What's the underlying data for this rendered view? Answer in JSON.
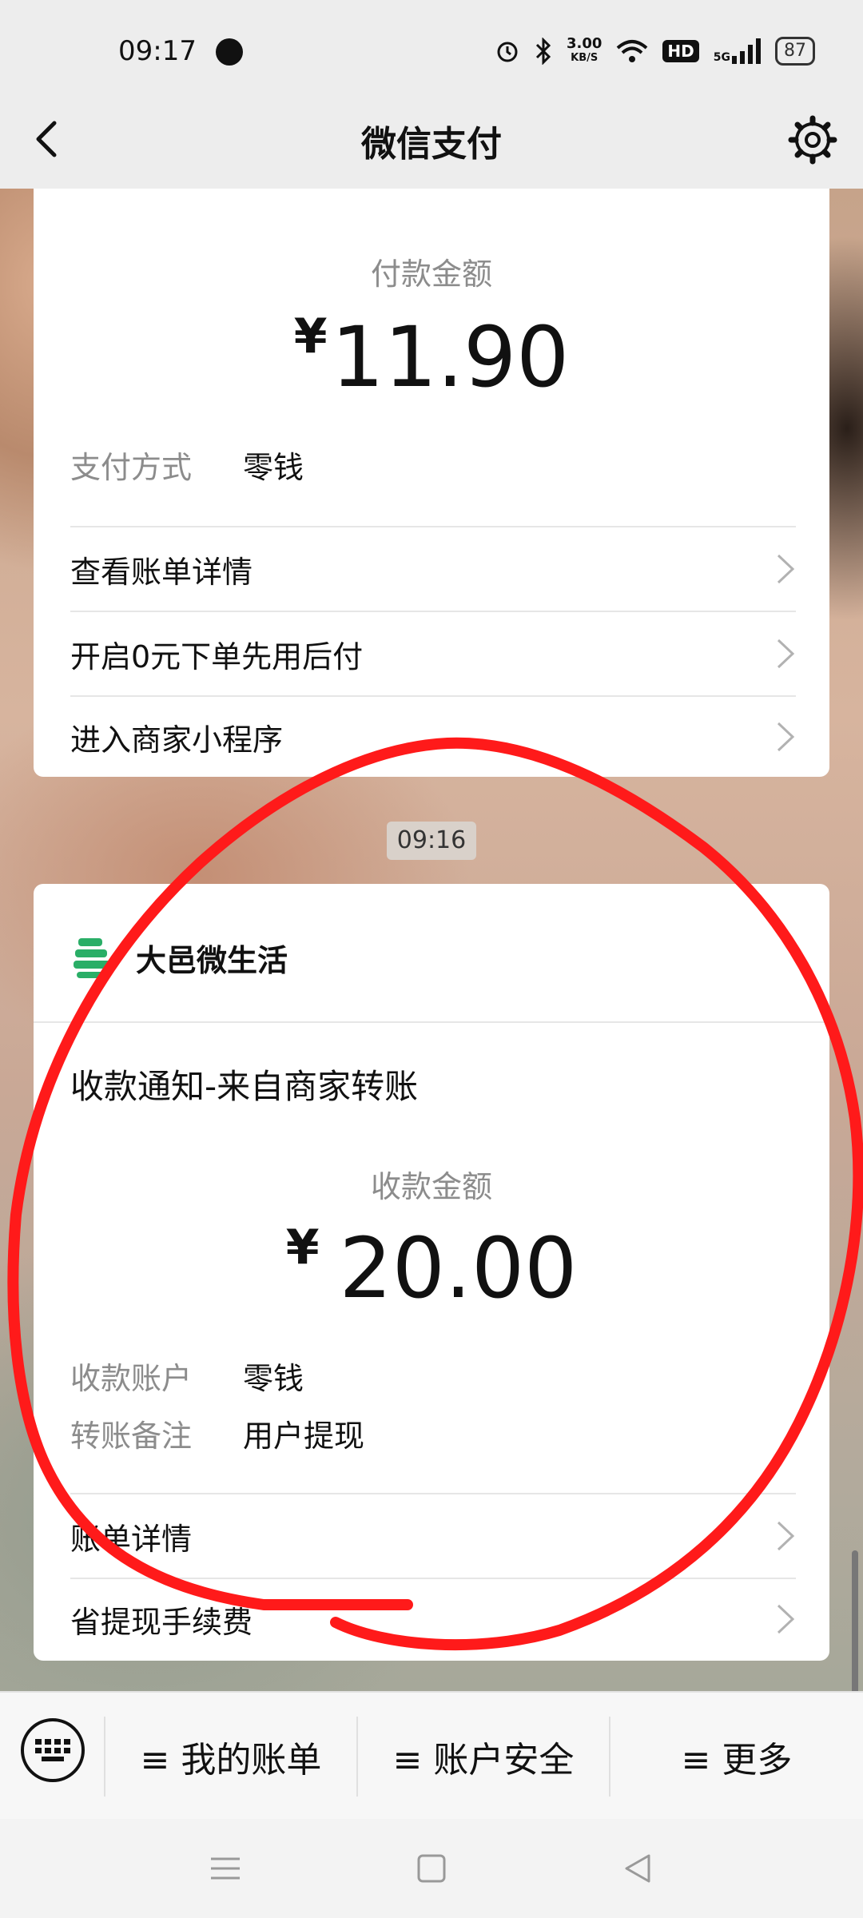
{
  "status_bar": {
    "time": "09:17",
    "net_speed": "3.00",
    "net_unit": "KB/S",
    "hd": "HD",
    "signal": "5G",
    "battery": "87"
  },
  "header": {
    "title": "微信支付"
  },
  "payment_card": {
    "amount_label": "付款金额",
    "currency": "¥",
    "amount": "11.90",
    "method_label": "支付方式",
    "method_value": "零钱",
    "links": [
      "查看账单详情",
      "开启0元下单先用后付",
      "进入商家小程序"
    ]
  },
  "timestamp": "09:16",
  "receipt_card": {
    "merchant_name": "大邑微生活",
    "notice": "收款通知-来自商家转账",
    "amount_label": "收款金额",
    "currency": "¥",
    "amount": "20.00",
    "account_label": "收款账户",
    "account_value": "零钱",
    "remark_label": "转账备注",
    "remark_value": "用户提现",
    "links": [
      "账单详情",
      "省提现手续费"
    ]
  },
  "bottom_menu": {
    "items": [
      "≡ 我的账单",
      "≡ 账户安全",
      "≡ 更多"
    ]
  },
  "colors": {
    "annotation_red": "#ff1a1a",
    "merchant_logo_green": "#2aae67",
    "header_bg": "#ededed"
  }
}
